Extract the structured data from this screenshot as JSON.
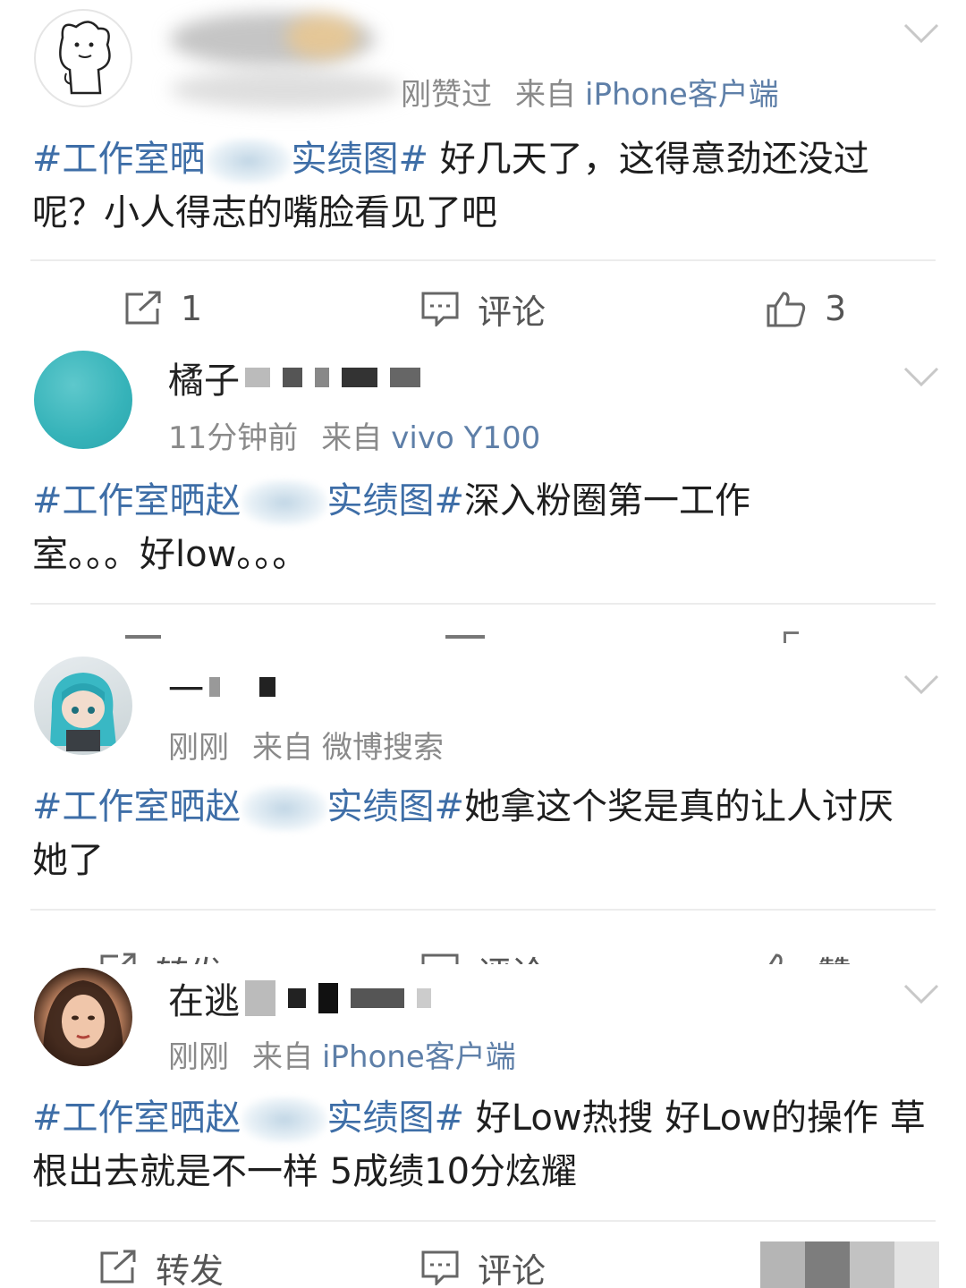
{
  "posts": [
    {
      "id": "p1",
      "username": "",
      "meta_time": "刚赞过",
      "source_label": "来自",
      "source": "iPhone客户端",
      "topic_start": "#工作室晒",
      "topic_end": "实绩图#",
      "text": " 好几天了，这得意劲还没过呢？小人得志的嘴脸看见了吧",
      "repost_count": "1",
      "comment_label": "评论",
      "like_count": "3"
    },
    {
      "id": "p2",
      "username": "橘子",
      "meta_time": "11分钟前",
      "source_label": "来自",
      "source": "vivo Y100",
      "topic_start": "#工作室晒赵",
      "topic_end": "实绩图#",
      "text": "深入粉圈第一工作室。。。好low。。。"
    },
    {
      "id": "p3",
      "username": "一",
      "meta_time": "刚刚",
      "source_label": "来自",
      "source": "微博搜索",
      "topic_start": "#工作室晒赵",
      "topic_end": "实绩图#",
      "text": "她拿这个奖是真的让人讨厌她了",
      "repost_label": "转发",
      "comment_label": "评论",
      "like_label": "赞"
    },
    {
      "id": "p4",
      "username": "在逃",
      "meta_time": "刚刚",
      "source_label": "来自",
      "source": "iPhone客户端",
      "topic_start": "#工作室晒赵",
      "topic_end": "实绩图#",
      "text": " 好Low热搜 好Low的操作 草根出去就是不一样 5成绩10分炫耀",
      "repost_label": "转发",
      "comment_label": "评论"
    }
  ],
  "colors": {
    "link": "#3e6ea7",
    "meta": "#8a8a8a",
    "source": "#5e7fa8",
    "action": "#555555",
    "divider": "#ececec"
  },
  "icons": [
    "repost-icon",
    "comment-icon",
    "like-icon",
    "chevron-down-icon"
  ]
}
